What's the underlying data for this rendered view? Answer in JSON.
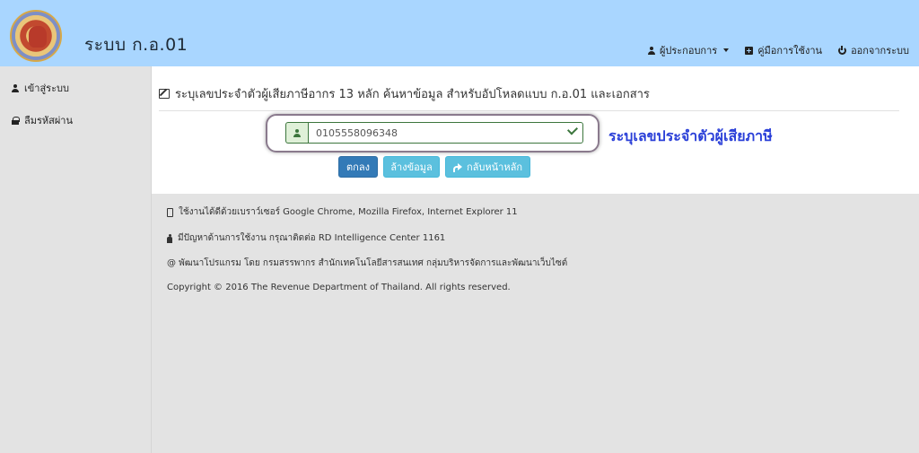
{
  "header": {
    "title": "ระบบ ก.อ.01",
    "nav": [
      {
        "label": "ผู้ประกอบการ",
        "icon": "user-icon"
      },
      {
        "label": "คู่มือการใช้งาน",
        "icon": "plus-square-icon"
      },
      {
        "label": "ออกจากระบบ",
        "icon": "power-icon"
      }
    ]
  },
  "sidebar": {
    "items": [
      {
        "label": "เข้าสู่ระบบ",
        "icon": "user-icon"
      },
      {
        "label": "ลืมรหัสผ่าน",
        "icon": "lock-icon"
      }
    ]
  },
  "main": {
    "heading": "ระบุเลขประจำตัวผู้เสียภาษีอากร 13 หลัก ค้นหาข้อมูล สำหรับอัปโหลดแบบ ก.อ.01 และเอกสาร",
    "tin_value": "0105558096348",
    "annotation": "ระบุเลขประจำตัวผู้เสียภาษี",
    "buttons": {
      "ok": "ตกลง",
      "clear": "ล้างข้อมูล",
      "home": "กลับหน้าหลัก"
    }
  },
  "footer": {
    "browser": "ใช้งานได้ดีด้วยเบราว์เซอร์ Google Chrome, Mozilla Firefox, Internet Explorer 11",
    "support": "มีปัญหาด้านการใช้งาน กรุณาติดต่อ RD Intelligence Center 1161",
    "developer": "@ พัฒนาโปรแกรม โดย กรมสรรพากร สำนักเทคโนโลยีสารสนเทศ กลุ่มบริหารจัดการและพัฒนาเว็บไซต์",
    "copyright": "Copyright © 2016 The Revenue Department of Thailand. All rights reserved."
  },
  "colors": {
    "header_bg": "#a9d6ff",
    "primary": "#337ab7",
    "info": "#5bc0de",
    "success": "#3c763d",
    "annotation": "#2a3fd8"
  }
}
